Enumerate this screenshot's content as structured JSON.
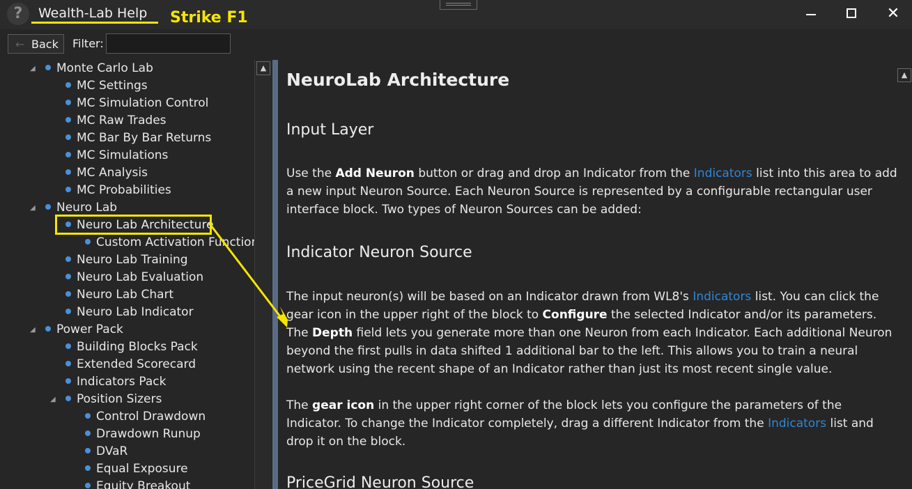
{
  "window": {
    "title": "Wealth-Lab Help",
    "annotation": "Strike F1",
    "help_icon": "?",
    "controls": {
      "minimize": "minimize-icon",
      "maximize": "maximize-icon",
      "close": "✕"
    }
  },
  "toolbar": {
    "back_label": "Back",
    "back_arrow": "←",
    "filter_label": "Filter:",
    "filter_value": ""
  },
  "tree": {
    "scroll_up": "▲",
    "items": [
      {
        "label": "Monte Carlo Lab",
        "expander": "◢"
      },
      {
        "label": "MC Settings"
      },
      {
        "label": "MC Simulation Control"
      },
      {
        "label": "MC Raw Trades"
      },
      {
        "label": "MC Bar By Bar Returns"
      },
      {
        "label": "MC Simulations"
      },
      {
        "label": "MC Analysis"
      },
      {
        "label": "MC Probabilities"
      },
      {
        "label": "Neuro Lab",
        "expander": "◢"
      },
      {
        "label": "Neuro Lab Architecture",
        "selected": true
      },
      {
        "label": "Custom Activation Functions"
      },
      {
        "label": "Neuro Lab Training"
      },
      {
        "label": "Neuro Lab Evaluation"
      },
      {
        "label": "Neuro Lab Chart"
      },
      {
        "label": "Neuro Lab Indicator"
      },
      {
        "label": "Power Pack",
        "expander": "◢"
      },
      {
        "label": "Building Blocks Pack"
      },
      {
        "label": "Extended Scorecard"
      },
      {
        "label": "Indicators Pack"
      },
      {
        "label": "Position Sizers",
        "expander": "◢"
      },
      {
        "label": "Control Drawdown"
      },
      {
        "label": "Drawdown Runup"
      },
      {
        "label": "DVaR"
      },
      {
        "label": "Equal Exposure"
      },
      {
        "label": "Equity Breakout"
      }
    ]
  },
  "content": {
    "title": "NeuroLab Architecture",
    "scroll_up": "▲",
    "sections": {
      "input_layer": {
        "heading": "Input Layer",
        "p1_a": "Use the ",
        "p1_b": "Add Neuron",
        "p1_c": " button or drag and drop an Indicator from the ",
        "p1_link": "Indicators",
        "p1_d": " list into this area to add a new input Neuron Source. Each Neuron Source is represented by a configurable rectangular user interface block. Two types of Neuron Sources can be added:"
      },
      "indicator_source": {
        "heading": "Indicator Neuron Source",
        "p2_a": "The input neuron(s) will be based on an Indicator drawn from WL8's ",
        "p2_link": "Indicators",
        "p2_b": " list. You can click the gear icon in the upper right of the block to ",
        "p2_c": "Configure",
        "p2_d": " the selected Indicator and/or its parameters. The ",
        "p2_e": "Depth",
        "p2_f": " field lets you generate more than one Neuron from each Indicator. Each additional Neuron beyond the first pulls in data shifted 1 additional bar to the left. This allows you to train a neural network using the recent shape of an Indicator rather than just its most recent single value.",
        "p3_a": "The ",
        "p3_b": "gear icon",
        "p3_c": " in the upper right corner of the block lets you configure the parameters of the Indicator. To change the Indicator completely, drag a different Indicator from the ",
        "p3_link": "Indicators",
        "p3_d": " list and drop it on the block."
      },
      "pricegrid_source": {
        "heading": "PriceGrid Neuron Source"
      }
    }
  },
  "colors": {
    "annotation": "#f5e600",
    "link": "#2f86d6",
    "bullet": "#4a90d9",
    "splitter": "#5b6b85"
  }
}
